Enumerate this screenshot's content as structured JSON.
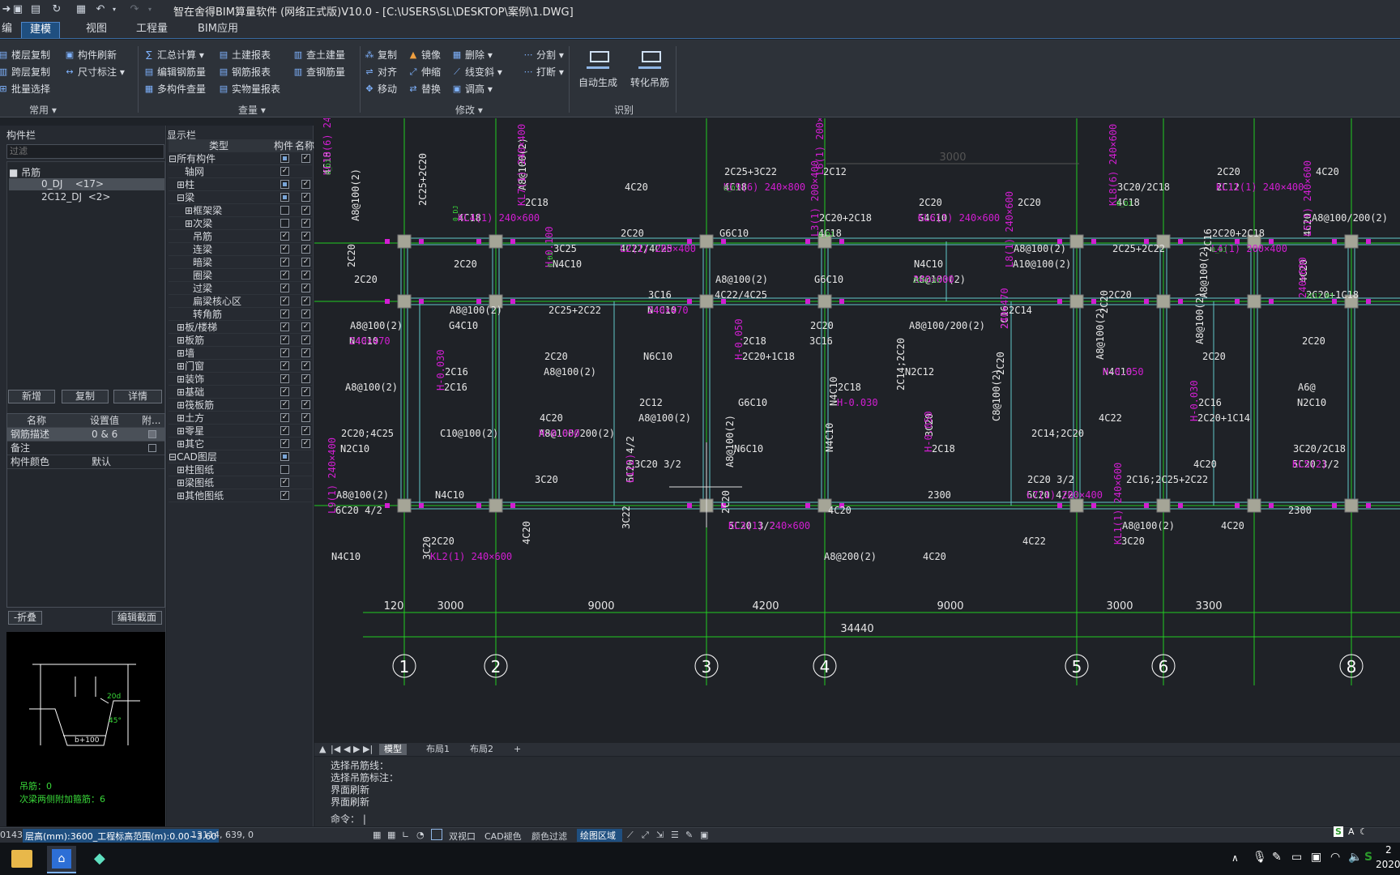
{
  "window": {
    "title": "智在舍得BIM算量软件 (网络正式版)V10.0 - [C:\\USERS\\SL\\DESKTOP\\案例\\1.DWG]"
  },
  "menu": {
    "tabs": [
      "建模",
      "视图",
      "工程量",
      "BIM应用"
    ],
    "partial_left": "编"
  },
  "ribbon": {
    "common": {
      "label": "常用 ▾",
      "items": [
        "楼层复制",
        "跨层复制",
        "批量选择",
        "构件刷新",
        "尺寸标注 ▾"
      ]
    },
    "query": {
      "label": "查量 ▾",
      "items": [
        "汇总计算 ▾",
        "编辑钢筋量",
        "多构件查量",
        "土建报表",
        "钢筋报表",
        "实物量报表",
        "查土建量",
        "查钢筋量"
      ]
    },
    "modify": {
      "label": "修改 ▾",
      "items": [
        "复制",
        "对齐",
        "移动",
        "镜像",
        "伸缩",
        "替换",
        "删除 ▾",
        "线变斜 ▾",
        "调高 ▾",
        "分割 ▾",
        "打断 ▾"
      ]
    },
    "identify": {
      "label": "识别",
      "items": [
        "自动生成",
        "转化吊筋"
      ]
    }
  },
  "component_panel": {
    "title": "构件栏",
    "search_placeholder": "过滤",
    "tree": {
      "root": "吊筋",
      "items": [
        {
          "name": "0_DJ",
          "count": "<17>"
        },
        {
          "name": "2C12_DJ",
          "count": "<2>"
        }
      ]
    },
    "buttons": {
      "add": "新增",
      "copy": "复制",
      "detail": "详情"
    },
    "properties": {
      "headers": [
        "名称",
        "设置值",
        "附..."
      ],
      "rows": [
        {
          "name": "钢筋描述",
          "value": "0 & 6"
        },
        {
          "name": "备注",
          "value": ""
        },
        {
          "name": "构件颜色",
          "value": "默认"
        }
      ]
    },
    "fold_button": "-折叠",
    "edit_section_button": "编辑截面",
    "preview": {
      "dims": [
        "b+100",
        "20d",
        "45°"
      ],
      "notes": [
        "吊筋：0",
        "次梁两侧附加箍筋：6"
      ]
    }
  },
  "display_panel": {
    "title": "显示栏",
    "headers": [
      "类型",
      "构件",
      "名称"
    ],
    "rows": [
      {
        "label": "所有构件",
        "prefix": "⊟",
        "indent": 0,
        "c1": "sq",
        "c2": "check"
      },
      {
        "label": "轴网",
        "prefix": "",
        "indent": 2,
        "c1": "check",
        "c2": ""
      },
      {
        "label": "柱",
        "prefix": "⊞",
        "indent": 1,
        "c1": "sq",
        "c2": "check"
      },
      {
        "label": "梁",
        "prefix": "⊟",
        "indent": 1,
        "c1": "sq",
        "c2": "check"
      },
      {
        "label": "框架梁",
        "prefix": "⊞",
        "indent": 2,
        "c1": "empty",
        "c2": "check"
      },
      {
        "label": "次梁",
        "prefix": "⊞",
        "indent": 2,
        "c1": "empty",
        "c2": "check"
      },
      {
        "label": "吊筋",
        "prefix": "",
        "indent": 3,
        "c1": "check",
        "c2": "check"
      },
      {
        "label": "连梁",
        "prefix": "",
        "indent": 3,
        "c1": "check",
        "c2": "check"
      },
      {
        "label": "暗梁",
        "prefix": "",
        "indent": 3,
        "c1": "check",
        "c2": "check"
      },
      {
        "label": "圈梁",
        "prefix": "",
        "indent": 3,
        "c1": "check",
        "c2": "check"
      },
      {
        "label": "过梁",
        "prefix": "",
        "indent": 3,
        "c1": "check",
        "c2": "check"
      },
      {
        "label": "扁梁核心区",
        "prefix": "",
        "indent": 3,
        "c1": "check",
        "c2": "check"
      },
      {
        "label": "转角筋",
        "prefix": "",
        "indent": 3,
        "c1": "check",
        "c2": "check"
      },
      {
        "label": "板/楼梯",
        "prefix": "⊞",
        "indent": 1,
        "c1": "check",
        "c2": "check"
      },
      {
        "label": "板筋",
        "prefix": "⊞",
        "indent": 1,
        "c1": "check",
        "c2": "check"
      },
      {
        "label": "墙",
        "prefix": "⊞",
        "indent": 1,
        "c1": "check",
        "c2": "check"
      },
      {
        "label": "门窗",
        "prefix": "⊞",
        "indent": 1,
        "c1": "check",
        "c2": "check"
      },
      {
        "label": "装饰",
        "prefix": "⊞",
        "indent": 1,
        "c1": "check",
        "c2": "check"
      },
      {
        "label": "基础",
        "prefix": "⊞",
        "indent": 1,
        "c1": "check",
        "c2": "check"
      },
      {
        "label": "筏板筋",
        "prefix": "⊞",
        "indent": 1,
        "c1": "check",
        "c2": "check"
      },
      {
        "label": "土方",
        "prefix": "⊞",
        "indent": 1,
        "c1": "check",
        "c2": "check"
      },
      {
        "label": "零星",
        "prefix": "⊞",
        "indent": 1,
        "c1": "check",
        "c2": "check"
      },
      {
        "label": "其它",
        "prefix": "⊞",
        "indent": 1,
        "c1": "check",
        "c2": "check"
      },
      {
        "label": "CAD图层",
        "prefix": "⊟",
        "indent": 0,
        "c1": "sq",
        "c2": ""
      },
      {
        "label": "柱图纸",
        "prefix": "⊞",
        "indent": 1,
        "c1": "empty",
        "c2": ""
      },
      {
        "label": "梁图纸",
        "prefix": "⊞",
        "indent": 1,
        "c1": "check",
        "c2": ""
      },
      {
        "label": "其他图纸",
        "prefix": "⊞",
        "indent": 1,
        "c1": "check",
        "c2": ""
      }
    ]
  },
  "drawing": {
    "axis_labels": [
      "1",
      "2",
      "3",
      "4",
      "5",
      "6",
      "8"
    ],
    "spans": [
      "120",
      "3000",
      "9000",
      "4200",
      "9000",
      "3000",
      "3300"
    ],
    "total": "34440",
    "top_dim": "3000",
    "texts_white": [
      "4C18",
      "4C18",
      "4C18",
      "4C18",
      "4C18",
      "2C16",
      "N4C10",
      "A8@100(2)",
      "2C20+1C18",
      "N4C10",
      "2C16",
      "N4C10",
      "2C20+1C18",
      "N4C10",
      "2C16",
      "N4C10",
      "2C20+1C14",
      "A8@100/200(2)",
      "2C18",
      "5C20 3/2",
      "6C20 4/2",
      "6C20 4/2",
      "6C20 4/2",
      "5C20 3/2",
      "3C20",
      "3C20",
      "2C12",
      "2C12",
      "2C18",
      "G4C10",
      "4C20",
      "4C22/4C25",
      "A10@100(2)",
      "2C20",
      "4C22/4C25",
      "2C20",
      "G4C10",
      "3C16",
      "2C20",
      "A8@100(2)",
      "2C14;2C20",
      "N2C10",
      "A8@100(2)",
      "2C14;2C20",
      "N2C10",
      "A8@100(2)",
      "2C16;2C25+2C22",
      "N4C10",
      "4C20",
      "4C20",
      "4C20",
      "4C20",
      "4C20",
      "4C20",
      "2C20",
      "A8@100(2)",
      "G6C10",
      "2C25+2C22",
      "2C20",
      "G6C10",
      "A8@100(2)",
      "2C25+2C22",
      "A8@100/200(2)",
      "2C20",
      "N6C10",
      "2C20",
      "A8@100(2)",
      "G6C10",
      "4C22",
      "C10@100(2)",
      "N4C10",
      "4C20",
      "3C20",
      "2300",
      "2300",
      "3C22",
      "4C22",
      "N4C10",
      "2C25+3C22",
      "3C20/2C18",
      "2C25+2C20",
      "2C20+2C18",
      "2C20+2C18",
      "3C25",
      "N4C10",
      "4C20",
      "3C16",
      "2C14",
      "A8@100(2)",
      "2C18",
      "A8@100(2)",
      "2C16",
      "2C18",
      "2C16",
      "4C20",
      "3C20",
      "3C20/2C18",
      "3C20 3/2",
      "2C20 3/2",
      "A8@100(2)",
      "2C20",
      "A8@100(2)",
      "2C20",
      "A8@200(2)",
      "2C20",
      "A8@100(2)",
      "2C20",
      "A8@100/200(2)",
      "2C20",
      "A8@100(2)",
      "2C20",
      "A8@100(2)",
      "2C20",
      "A8@100(2)",
      "2C20",
      "A8@100(2)",
      "2C20",
      "N2C12",
      "A6@",
      "2C12",
      "C8@100(2)",
      "2C20;4C25",
      "N6C10"
    ],
    "texts_magenta": [
      "KL10(6) 240×500",
      "KL9(6) 240×800",
      "KL8(6) 240×600",
      "KL4(1) 240×600",
      "L3(1) 200×400",
      "L4(1) 200×400",
      "H-0.100",
      "240×600",
      "240×600",
      "240×470",
      "240×470",
      "240×470",
      "H-0.050",
      "H-0.050",
      "H-0.030",
      "H-0.030",
      "H-0.030",
      "H-0.050",
      "H-0.050",
      "KL5(2)",
      "L1(2)",
      "L7(1) 200×400",
      "L9(1) 240×400",
      "KL3(1) 240×600",
      "KL1(1) 240×600",
      "KL2(1) 240×600",
      "L6(1) 200×400",
      "KL11(1) 240×400",
      "KL7(1) 240×400",
      "KL6(1) 240×600",
      "L5(1) 240×600",
      "L2(1) 200×400",
      "L8(1) 240×600"
    ],
    "texts_green": [
      "0_DJ",
      "0_DJ",
      "0_DJ",
      "0_DJ",
      "0_DJ",
      "0_DJ",
      "0_DJ",
      "2C12_DJ",
      "2C12_DJ"
    ]
  },
  "layout_tabs": {
    "tabs": [
      "模型",
      "布局1",
      "布局2"
    ],
    "add": "+"
  },
  "command": {
    "history": [
      "选择吊筋线：",
      "选择吊筋标注：",
      "界面刷新",
      "界面刷新"
    ],
    "prompt": "命令："
  },
  "status": {
    "partial_left": "01434",
    "level_info": "层高(mm):3600_工程标高范围(m):0.00~3.60",
    "coords": "13114, 639, 0",
    "toggles": [
      "双视口",
      "CAD褪色",
      "颜色过滤"
    ],
    "draw_area": "绘图区域"
  },
  "taskbar": {
    "ime": "S",
    "ime_mode": "A",
    "time_partial": "2",
    "date_partial": "2020"
  },
  "colors": {
    "accent": "#1f4f80",
    "canvas_bg": "#1f2227",
    "axis_green": "#22cc22",
    "beam_cyan": "#62c8c8",
    "column_fill": "#a5a597",
    "magenta": "#d21ed2",
    "text_white": "#e6e6e6"
  }
}
